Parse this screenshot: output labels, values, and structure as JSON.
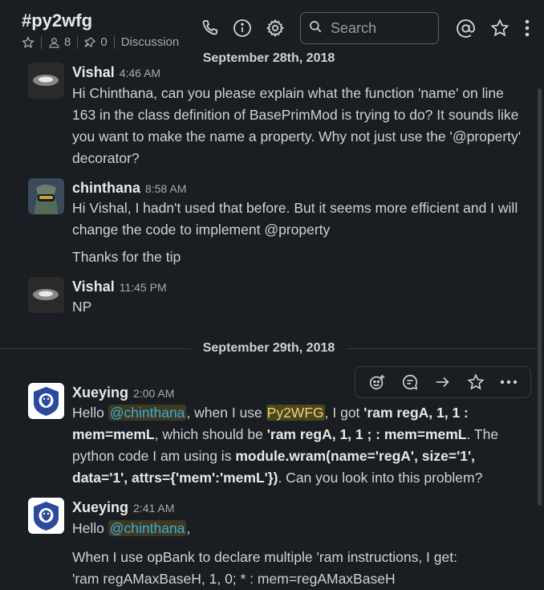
{
  "channel": {
    "name": "#py2wfg",
    "members_count": "8",
    "pins_count": "0",
    "tab_label": "Discussion"
  },
  "header": {
    "search_placeholder": "Search",
    "icons": [
      "phone-icon",
      "info-icon",
      "gear-icon",
      "search-icon",
      "at-icon",
      "star-icon",
      "more-vertical-icon"
    ]
  },
  "dates": {
    "first": "September 28th, 2018",
    "second": "September 29th, 2018"
  },
  "messages": [
    {
      "sender": "Vishal",
      "time": "4:46 AM",
      "text": "Hi  Chinthana, can you please explain what the function 'name' on line 163 in the class definition of BasePrimMod is trying to do? It sounds like you want to make the name a property. Why not just use the '@property' decorator?"
    },
    {
      "sender": "chinthana",
      "time": "8:58 AM",
      "text": "Hi Vishal, I hadn't used that before. But it seems more efficient and I will change the code to implement @property",
      "text2": "Thanks for the tip"
    },
    {
      "sender": "Vishal",
      "time": "11:45 PM",
      "text": "NP"
    },
    {
      "sender": "Xueying",
      "time": "2:00 AM",
      "t1": "Hello ",
      "mention": "@chinthana",
      "t2": ", when I use ",
      "highlight": "Py2WFG",
      "t3": ", I got ",
      "b1": "'ram regA, 1, 1 : mem=memL",
      "t4": ", which should be ",
      "b2": "'ram regA, 1, 1 ; : mem=memL",
      "t5": ". The python code I am using is ",
      "b3": "module.wram(name='regA', size='1', data='1', attrs={'mem':'memL'})",
      "t6": ". Can you look into this problem?"
    },
    {
      "sender": "Xueying",
      "time": "2:41 AM",
      "t1": "Hello ",
      "mention": "@chinthana",
      "t2": ",",
      "text2": "When I use opBank to declare multiple 'ram instructions, I get:",
      "text3": "'ram regAMaxBaseH, 1, 0; * : mem=regAMaxBaseH"
    }
  ],
  "message_actions": [
    "add-reaction-icon",
    "reply-in-thread-icon",
    "share-message-icon",
    "save-star-icon",
    "more-actions-icon"
  ],
  "colors": {
    "background": "#1a1d21",
    "text": "#d1d2d3",
    "mention": "#3dabe0",
    "mention_bg": "#3d3a1f",
    "highlight_bg": "#4d4617"
  }
}
